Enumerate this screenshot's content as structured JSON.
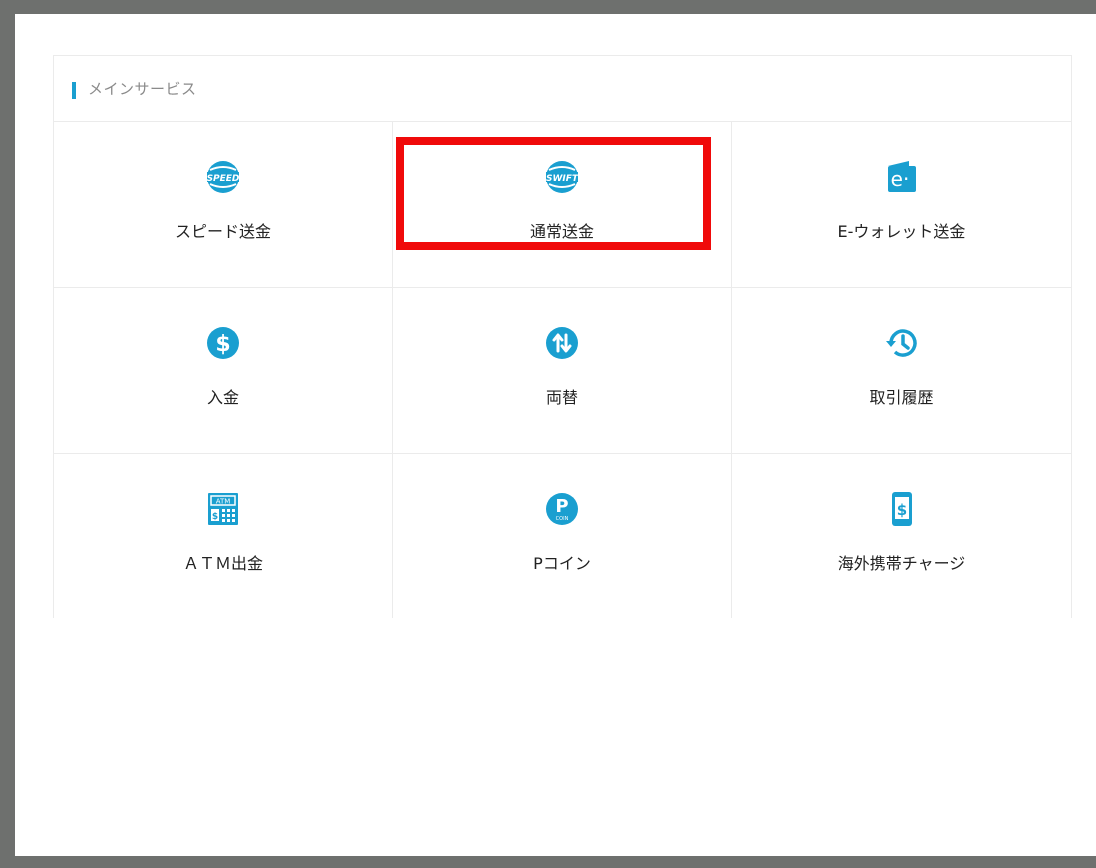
{
  "section": {
    "title": "メインサービス"
  },
  "colors": {
    "accent": "#1a9fd0",
    "highlight": "#f00a0a"
  },
  "services": [
    {
      "label": "スピード送金",
      "icon": "speed-globe-icon",
      "icon_text": "SPEED"
    },
    {
      "label": "通常送金",
      "icon": "swift-globe-icon",
      "icon_text": "SWIFT"
    },
    {
      "label": "E-ウォレット送金",
      "icon": "ewallet-icon",
      "icon_text": "e·"
    },
    {
      "label": "入金",
      "icon": "dollar-icon",
      "icon_text": "$"
    },
    {
      "label": "両替",
      "icon": "exchange-arrows-icon",
      "icon_text": ""
    },
    {
      "label": "取引履歴",
      "icon": "history-clock-icon",
      "icon_text": ""
    },
    {
      "label": "ＡＴＭ出金",
      "icon": "atm-icon",
      "icon_text": "ATM"
    },
    {
      "label": "Pコイン",
      "icon": "pcoin-icon",
      "icon_text": "P",
      "icon_subtext": "COIN"
    },
    {
      "label": "海外携帯チャージ",
      "icon": "mobile-charge-icon",
      "icon_text": "$"
    }
  ]
}
